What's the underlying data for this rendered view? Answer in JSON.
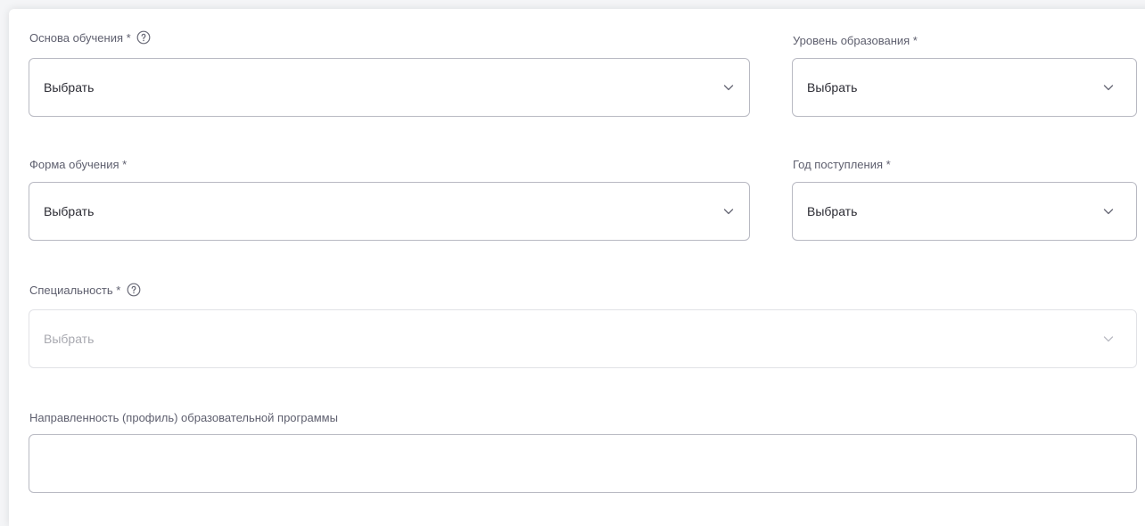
{
  "form": {
    "basis": {
      "label": "Основа обучения *",
      "value": "Выбрать"
    },
    "level": {
      "label": "Уровень образования *",
      "value": "Выбрать"
    },
    "form_type": {
      "label": "Форма обучения *",
      "value": "Выбрать"
    },
    "year": {
      "label": "Год поступления *",
      "value": "Выбрать"
    },
    "specialty": {
      "label": "Специальность *",
      "value": "Выбрать",
      "disabled": true
    },
    "profile": {
      "label": "Направленность (профиль) образовательной программы",
      "value": ""
    }
  },
  "icons": {
    "help": "help-circle-icon",
    "dropdown": "chevron-down-icon"
  },
  "colors": {
    "border": "#b8b9c2",
    "border_disabled": "#e1e2e6",
    "label": "#5e5f6e",
    "text": "#2b2b33",
    "text_disabled": "#a8a9b0"
  }
}
